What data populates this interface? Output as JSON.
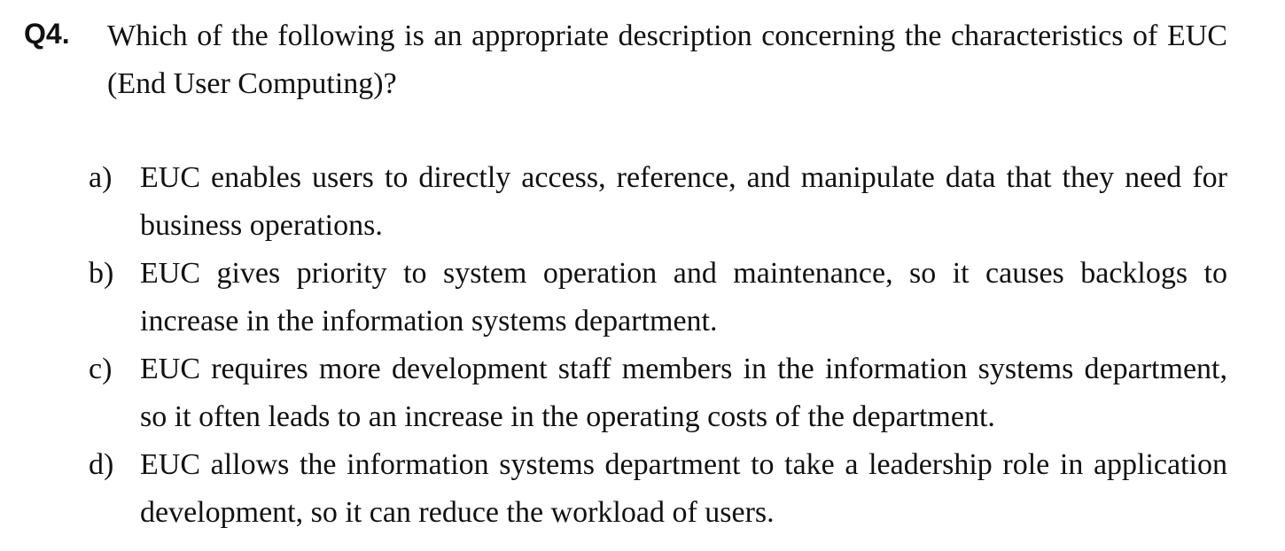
{
  "question": {
    "number": "Q4.",
    "stem": "Which of the following is an appropriate description concerning the characteristics of EUC (End User Computing)?"
  },
  "options": [
    {
      "letter": "a)",
      "text": "EUC enables users to directly access, reference, and manipulate data that they need for business operations."
    },
    {
      "letter": "b)",
      "text": "EUC gives priority to system operation and maintenance, so it causes backlogs to increase in the information systems department."
    },
    {
      "letter": "c)",
      "text": "EUC requires more development staff members in the information systems department, so it often leads to an increase in the operating costs of the department."
    },
    {
      "letter": "d)",
      "text": "EUC allows the information systems department to take a leadership role in application development, so it can reduce the workload of users."
    }
  ]
}
